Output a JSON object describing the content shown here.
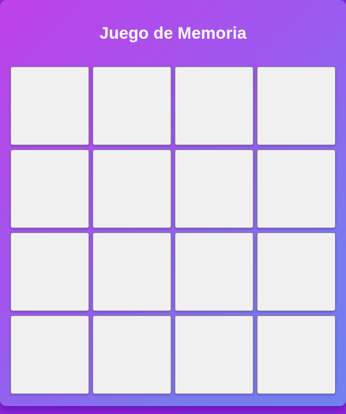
{
  "game": {
    "title": "Juego de Memoria",
    "rows": 4,
    "columns": 4,
    "cards": [
      {
        "face": "hidden"
      },
      {
        "face": "hidden"
      },
      {
        "face": "hidden"
      },
      {
        "face": "hidden"
      },
      {
        "face": "hidden"
      },
      {
        "face": "hidden"
      },
      {
        "face": "hidden"
      },
      {
        "face": "hidden"
      },
      {
        "face": "hidden"
      },
      {
        "face": "hidden"
      },
      {
        "face": "hidden"
      },
      {
        "face": "hidden"
      },
      {
        "face": "hidden"
      },
      {
        "face": "hidden"
      },
      {
        "face": "hidden"
      },
      {
        "face": "hidden"
      }
    ]
  },
  "colors": {
    "gradient_start": "#bf41e8",
    "gradient_end": "#6f81ef",
    "card_back": "#f0f0f0",
    "title_text": "#ffffff"
  }
}
